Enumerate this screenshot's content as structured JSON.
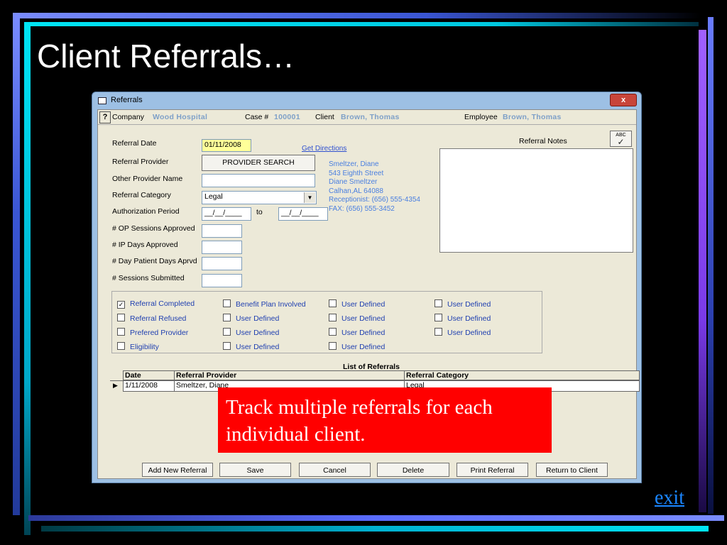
{
  "slide": {
    "title": "Client Referrals…",
    "exit": "exit"
  },
  "window": {
    "title": "Referrals",
    "close": "x"
  },
  "infobar": {
    "help": "?",
    "company_label": "Company",
    "company": "Wood Hospital",
    "case_label": "Case #",
    "case": "100001",
    "client_label": "Client",
    "client": "Brown, Thomas",
    "employee_label": "Employee",
    "employee": "Brown, Thomas"
  },
  "form": {
    "referral_date_label": "Referral Date",
    "referral_date": "01/11/2008",
    "get_directions": "Get Directions",
    "referral_provider_label": "Referral Provider",
    "provider_search": "PROVIDER SEARCH",
    "other_provider_label": "Other Provider Name",
    "other_provider": "",
    "category_label": "Referral Category",
    "category": "Legal",
    "auth_label": "Authorization Period",
    "auth_from": "__/__/____",
    "to": "to",
    "auth_to": "__/__/____",
    "op_label": "# OP Sessions Approved",
    "ip_label": "# IP Days Approved",
    "day_label": "# Day Patient Days Aprvd",
    "sessions_label": "# Sessions Submitted"
  },
  "provider_info": {
    "name": "Smeltzer, Diane",
    "street": "543 Eighth Street",
    "contact": "Diane Smeltzer",
    "city": "Calhan,AL 64088",
    "phone": "Receptionist: (656) 555-4354",
    "fax": "FAX: (656) 555-3452"
  },
  "notes": {
    "label": "Referral Notes",
    "spell": "ABC"
  },
  "checkboxes": {
    "c1": [
      "Referral Completed",
      "Referral Refused",
      "Prefered Provider",
      "Eligibility"
    ],
    "c2": [
      "Benefit Plan Involved",
      "User Defined",
      "User Defined",
      "User Defined"
    ],
    "c3": [
      "User Defined",
      "User Defined",
      "User Defined",
      "User Defined"
    ],
    "c4": [
      "User Defined",
      "User Defined",
      "User Defined"
    ],
    "checked_mark": "✓"
  },
  "list": {
    "title": "List of Referrals",
    "headers": [
      "Date",
      "Referral Provider",
      "Referral Category"
    ],
    "rows": [
      [
        "1/11/2008",
        "Smeltzer, Diane",
        "Legal"
      ]
    ]
  },
  "buttons": [
    "Add New Referral",
    "Save",
    "Cancel",
    "Delete",
    "Print Referral",
    "Return to Client"
  ],
  "callout": "Track multiple referrals for each individual client."
}
